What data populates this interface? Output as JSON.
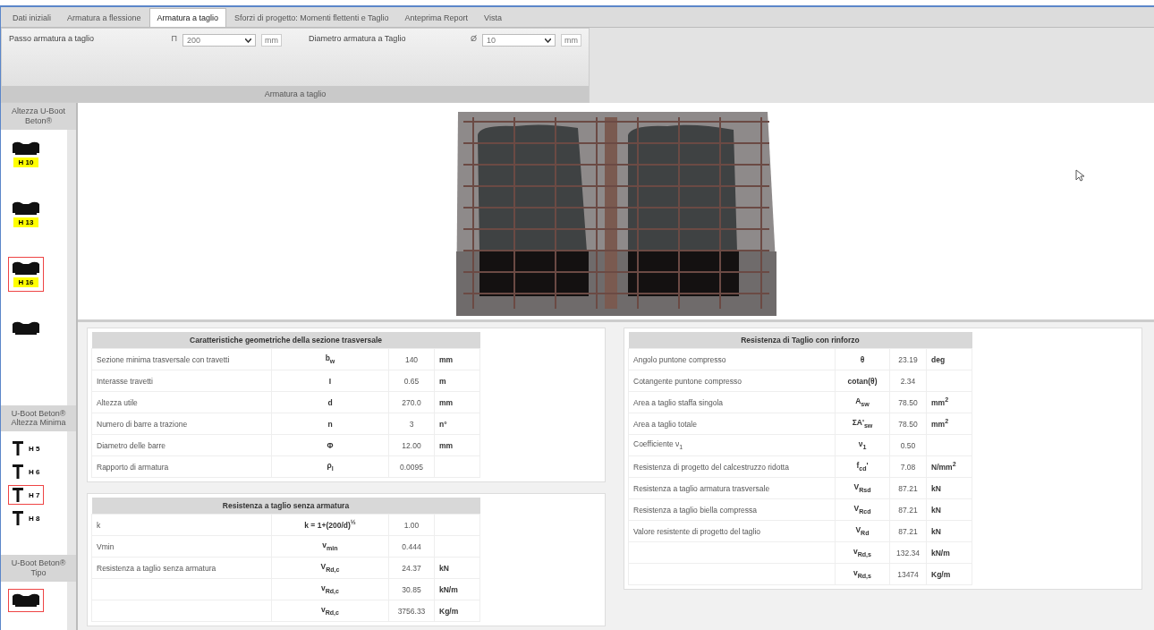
{
  "tabs": [
    {
      "label": "Dati iniziali",
      "selected": false
    },
    {
      "label": "Armatura a flessione",
      "selected": false
    },
    {
      "label": "Armatura a taglio",
      "selected": true
    },
    {
      "label": "Sforzi di progetto: Momenti flettenti e Taglio",
      "selected": false
    },
    {
      "label": "Anteprima Report",
      "selected": false
    },
    {
      "label": "Vista",
      "selected": false
    }
  ],
  "toolbar": {
    "fields": [
      {
        "label": "Passo armatura a taglio",
        "symbol": "Π",
        "value": "200",
        "unit": "mm"
      },
      {
        "label": "Diametro armatura a Taglio",
        "symbol": "Ø",
        "value": "10",
        "unit": "mm"
      }
    ],
    "group_title": "Armatura a taglio"
  },
  "sidebar": [
    {
      "title": "Altezza U-Boot Beton®",
      "items": [
        {
          "label": "H 10",
          "selected": false
        },
        {
          "label": "H 13",
          "selected": false
        },
        {
          "label": "H 16",
          "selected": true
        },
        {
          "selected": false
        }
      ]
    },
    {
      "title": "U-Boot Beton® Altezza Minima",
      "items": [
        {
          "label": "H 5",
          "selected": false
        },
        {
          "label": "H 6",
          "selected": false
        },
        {
          "label": "H 7",
          "selected": true
        },
        {
          "label": "H 8",
          "selected": false
        }
      ]
    },
    {
      "title": "U-Boot Beton® Tipo",
      "items": [
        {
          "selected": true
        }
      ]
    }
  ],
  "tables": [
    {
      "title": "Caratteristiche geometriche della sezione trasversale",
      "rows": [
        {
          "label": "Sezione minima trasversale con travetti",
          "symbol": "b$_{w}$",
          "value": "140",
          "unit": "mm"
        },
        {
          "label": "Interasse travetti",
          "symbol": "I",
          "value": "0.65",
          "unit": "m"
        },
        {
          "label": "Altezza utile",
          "symbol": "d",
          "value": "270.0",
          "unit": "mm"
        },
        {
          "label": "Numero di barre a trazione",
          "symbol": "n",
          "value": "3",
          "unit": "n°"
        },
        {
          "label": "Diametro delle barre",
          "symbol": "Φ",
          "value": "12.00",
          "unit": "mm"
        },
        {
          "label": "Rapporto di armatura",
          "symbol": "ρ$_{l}$",
          "value": "0.0095"
        }
      ]
    },
    {
      "title": "Resistenza a taglio senza armatura",
      "rows": [
        {
          "label": "k",
          "symbol": "k = 1+(200/d)$^{½}$",
          "value": "1.00"
        },
        {
          "label": "Vmin",
          "symbol": "v$_{min}$",
          "value": "0.444"
        },
        {
          "label": "Resistenza a taglio senza armatura",
          "symbol": "V$_{Rd,c}$",
          "value": "24.37",
          "unit": "kN"
        },
        {
          "symbol": "v$_{Rd,c}$",
          "value": "30.85",
          "unit": "kN/m"
        },
        {
          "symbol": "v$_{Rd,c}$",
          "value": "3756.33",
          "unit": "Kg/m"
        }
      ]
    },
    {
      "title": "Resistenza di Taglio con rinforzo",
      "rows": [
        {
          "label": "Angolo puntone compresso",
          "symbol": "θ",
          "value": "23.19",
          "unit": "deg"
        },
        {
          "label": "Cotangente puntone compresso",
          "symbol": "cotan(θ)",
          "value": "2.34"
        },
        {
          "label": "Area a taglio staffa singola",
          "symbol": "A$_{sw}$",
          "value": "78.50",
          "unit": "mm$^{2}$"
        },
        {
          "label": "Area a taglio totale",
          "symbol": "ΣA'$_{sw}$",
          "value": "78.50",
          "unit": "mm$^{2}$"
        },
        {
          "label": "Coefficiente ν$_{1}$",
          "symbol": "ν$_{1}$",
          "value": "0.50"
        },
        {
          "label": "Resistenza di progetto del calcestruzzo ridotta",
          "symbol": "f$_{cd}$'",
          "value": "7.08",
          "unit": "N/mm$^{2}$"
        },
        {
          "label": "Resistenza a taglio armatura trasversale",
          "symbol": "V$_{Rsd}$",
          "value": "87.21",
          "unit": "kN"
        },
        {
          "label": "Resistenza a taglio biella compressa",
          "symbol": "V$_{Rcd}$",
          "value": "87.21",
          "unit": "kN"
        },
        {
          "label": "Valore resistente di progetto del taglio",
          "symbol": "V$_{Rd}$",
          "value": "87.21",
          "unit": "kN"
        },
        {
          "symbol": "v$_{Rd,s}$",
          "value": "132.34",
          "unit": "kN/m"
        },
        {
          "symbol": "v$_{Rd,s}$",
          "value": "13474",
          "unit": "Kg/m"
        }
      ]
    }
  ]
}
